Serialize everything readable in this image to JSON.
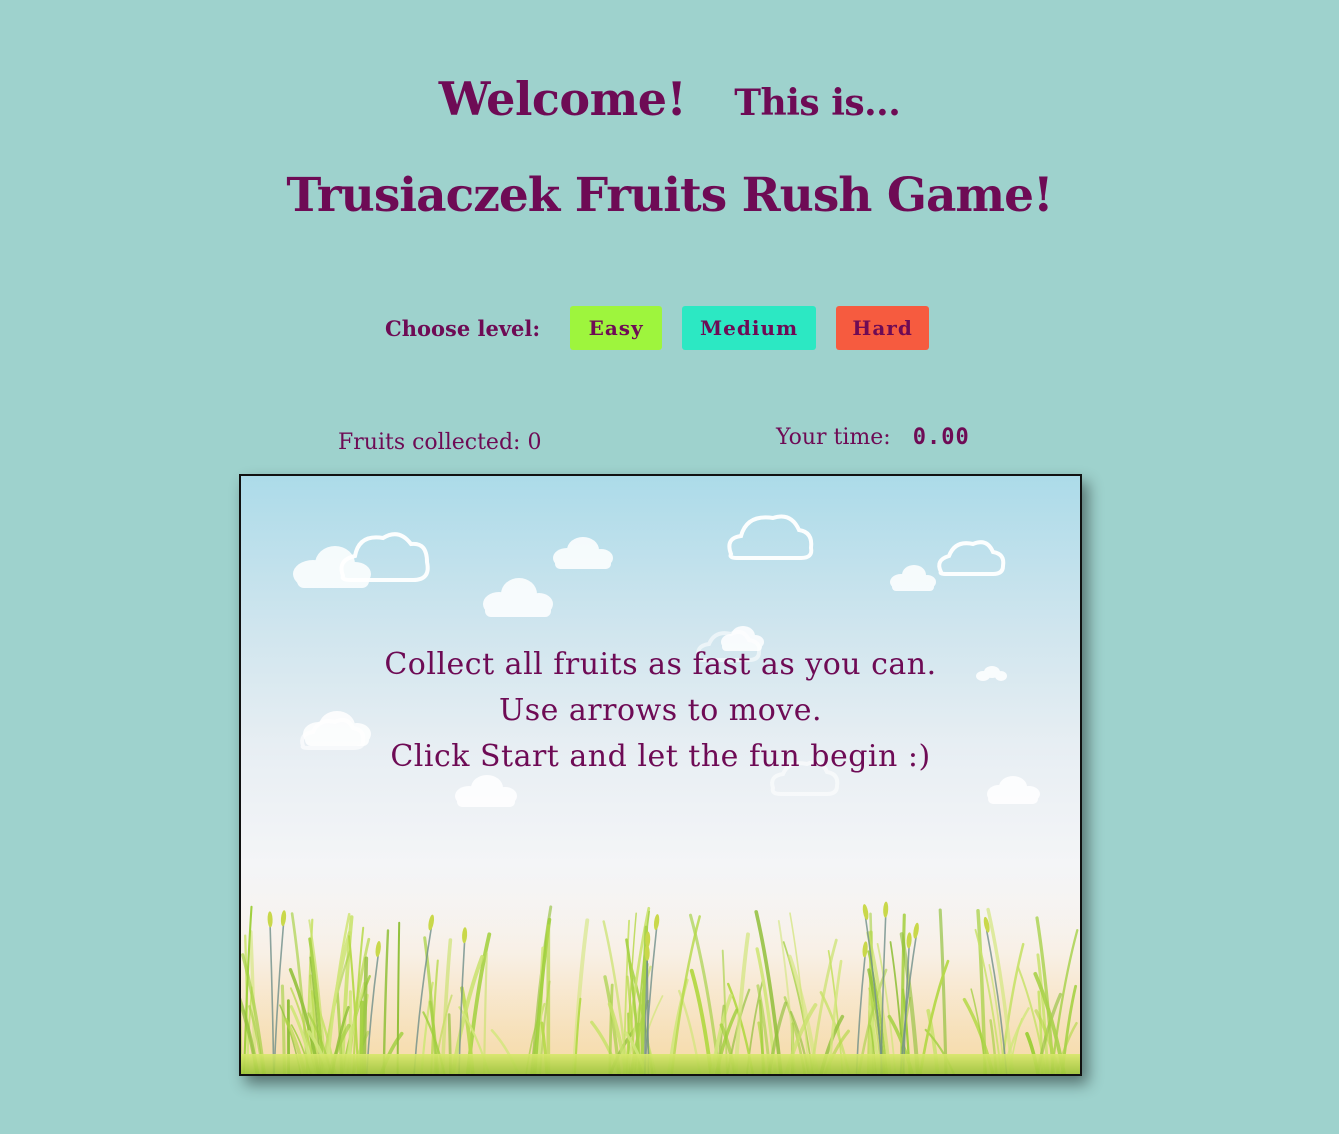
{
  "header": {
    "welcome": "Welcome!",
    "this_is": "This is...",
    "title": "Trusiaczek Fruits Rush Game!"
  },
  "levels": {
    "label": "Choose level:",
    "options": [
      "Easy",
      "Medium",
      "Hard"
    ],
    "colors": {
      "easy": "#9ef53d",
      "medium": "#2ce8c3",
      "hard": "#f65b3f"
    }
  },
  "stats": {
    "fruits_label": "Fruits collected:",
    "fruits_count": "0",
    "time_label": "Your time:",
    "time_value": "0.00"
  },
  "game": {
    "instructions": [
      "Collect all fruits as fast as you can.",
      "Use arrows to move.",
      "Click Start and let the fun begin :)"
    ]
  },
  "colors": {
    "background": "#9ed2cd",
    "text": "#6e0b55"
  }
}
